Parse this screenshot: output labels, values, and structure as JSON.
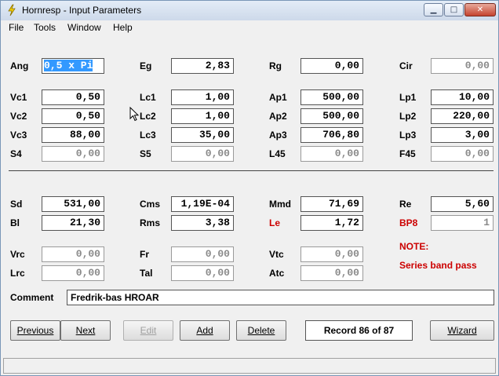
{
  "window": {
    "title": "Hornresp - Input Parameters",
    "colors": {
      "selection": "#3399ff",
      "warning": "#cc0000"
    }
  },
  "menu": [
    "File",
    "Tools",
    "Window",
    "Help"
  ],
  "rows": {
    "r1": [
      {
        "label": "Ang",
        "value": "0,5 x Pi",
        "state": "selected"
      },
      {
        "label": "Eg",
        "value": "2,83"
      },
      {
        "label": "Rg",
        "value": "0,00"
      },
      {
        "label": "Cir",
        "value": "0,00",
        "state": "disabled"
      }
    ],
    "r2": [
      {
        "label": "Vc1",
        "value": "0,50"
      },
      {
        "label": "Lc1",
        "value": "1,00"
      },
      {
        "label": "Ap1",
        "value": "500,00"
      },
      {
        "label": "Lp1",
        "value": "10,00"
      }
    ],
    "r3": [
      {
        "label": "Vc2",
        "value": "0,50"
      },
      {
        "label": "Lc2",
        "value": "1,00"
      },
      {
        "label": "Ap2",
        "value": "500,00"
      },
      {
        "label": "Lp2",
        "value": "220,00"
      }
    ],
    "r4": [
      {
        "label": "Vc3",
        "value": "88,00"
      },
      {
        "label": "Lc3",
        "value": "35,00"
      },
      {
        "label": "Ap3",
        "value": "706,80"
      },
      {
        "label": "Lp3",
        "value": "3,00"
      }
    ],
    "r5": [
      {
        "label": "S4",
        "value": "0,00",
        "state": "disabled"
      },
      {
        "label": "S5",
        "value": "0,00",
        "state": "disabled"
      },
      {
        "label": "L45",
        "value": "0,00",
        "state": "disabled"
      },
      {
        "label": "F45",
        "value": "0,00",
        "state": "disabled"
      }
    ],
    "r6": [
      {
        "label": "Sd",
        "value": "531,00"
      },
      {
        "label": "Cms",
        "value": "1,19E-04"
      },
      {
        "label": "Mmd",
        "value": "71,69"
      },
      {
        "label": "Re",
        "value": "5,60"
      }
    ],
    "r7": [
      {
        "label": "Bl",
        "value": "21,30"
      },
      {
        "label": "Rms",
        "value": "3,38"
      },
      {
        "label": "Le",
        "value": "1,72",
        "label_color": "red"
      },
      {
        "label": "BP8",
        "value": "1",
        "state": "disabled",
        "label_color": "red"
      }
    ],
    "r8": [
      {
        "label": "Vrc",
        "value": "0,00",
        "state": "disabled"
      },
      {
        "label": "Fr",
        "value": "0,00",
        "state": "disabled"
      },
      {
        "label": "Vtc",
        "value": "0,00",
        "state": "disabled"
      }
    ],
    "r9": [
      {
        "label": "Lrc",
        "value": "0,00",
        "state": "disabled"
      },
      {
        "label": "Tal",
        "value": "0,00",
        "state": "disabled"
      },
      {
        "label": "Atc",
        "value": "0,00",
        "state": "disabled"
      }
    ]
  },
  "note": {
    "title": "NOTE:",
    "text": "Series band pass"
  },
  "comment": {
    "label": "Comment",
    "value": "Fredrik-bas HROAR"
  },
  "buttons": {
    "previous": "Previous",
    "next": "Next",
    "edit": "Edit",
    "add": "Add",
    "delete": "Delete",
    "wizard": "Wizard"
  },
  "record": "Record 86 of 87",
  "icons": [
    "app-icon",
    "minimize-icon",
    "maximize-icon",
    "close-icon",
    "mouse-cursor-icon"
  ]
}
